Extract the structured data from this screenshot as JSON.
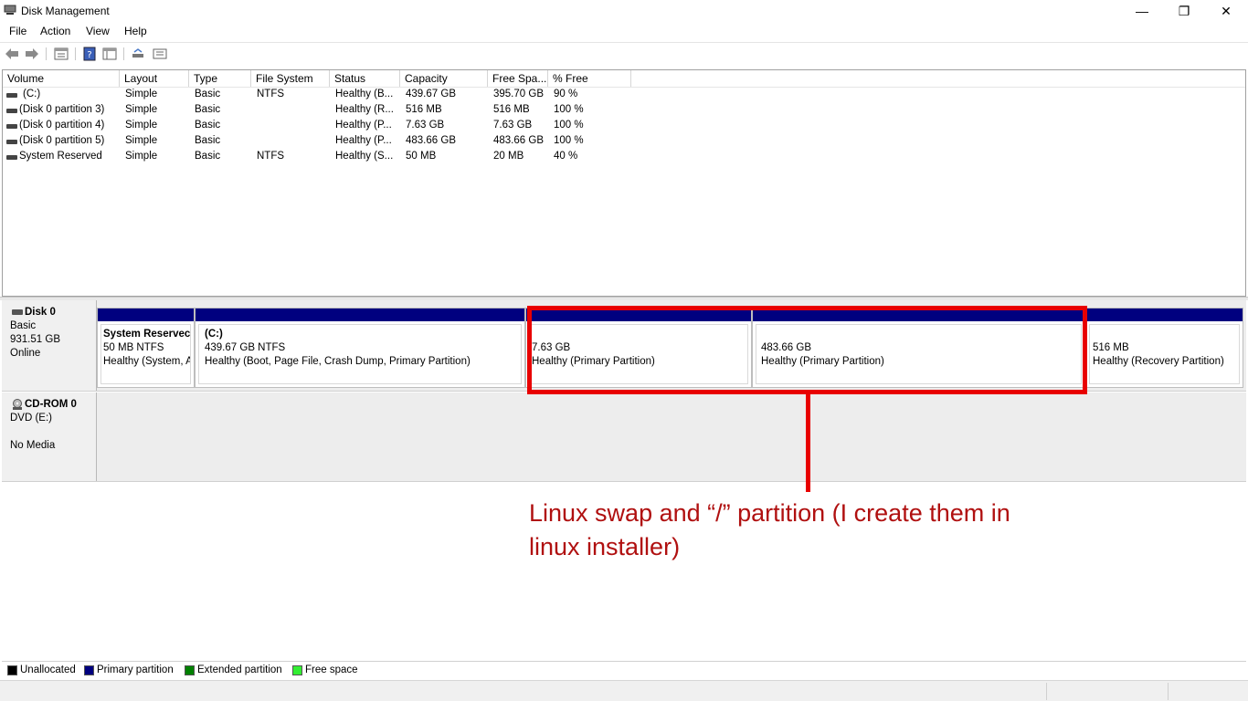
{
  "window": {
    "title": "Disk Management",
    "minimize_glyph": "—",
    "restore_glyph": "❐",
    "close_glyph": "✕"
  },
  "menu": [
    "File",
    "Action",
    "View",
    "Help"
  ],
  "toolbar_icons": [
    "back-arrow-icon",
    "forward-arrow-icon",
    "properties-icon",
    "help-icon",
    "details-icon",
    "rescan-icon",
    "settings-icon"
  ],
  "volume_list": {
    "columns": [
      "Volume",
      "Layout",
      "Type",
      "File System",
      "Status",
      "Capacity",
      "Free Spa...",
      "% Free"
    ],
    "rows": [
      {
        "volume": "(C:)",
        "layout": "Simple",
        "type": "Basic",
        "fs": "NTFS",
        "status": "Healthy (B...",
        "capacity": "439.67 GB",
        "free": "395.70 GB",
        "pct": "90 %"
      },
      {
        "volume": "(Disk 0 partition 3)",
        "layout": "Simple",
        "type": "Basic",
        "fs": "",
        "status": "Healthy (R...",
        "capacity": "516 MB",
        "free": "516 MB",
        "pct": "100 %"
      },
      {
        "volume": "(Disk 0 partition 4)",
        "layout": "Simple",
        "type": "Basic",
        "fs": "",
        "status": "Healthy (P...",
        "capacity": "7.63 GB",
        "free": "7.63 GB",
        "pct": "100 %"
      },
      {
        "volume": "(Disk 0 partition 5)",
        "layout": "Simple",
        "type": "Basic",
        "fs": "",
        "status": "Healthy (P...",
        "capacity": "483.66 GB",
        "free": "483.66 GB",
        "pct": "100 %"
      },
      {
        "volume": "System Reserved",
        "layout": "Simple",
        "type": "Basic",
        "fs": "NTFS",
        "status": "Healthy (S...",
        "capacity": "50 MB",
        "free": "20 MB",
        "pct": "40 %"
      }
    ]
  },
  "disks": [
    {
      "name": "Disk 0",
      "type": "Basic",
      "size": "931.51 GB",
      "state": "Online",
      "partitions": [
        {
          "name": "System Reservec",
          "size": "50 MB NTFS",
          "status": "Healthy (System, A"
        },
        {
          "name": "(C:)",
          "size": "439.67 GB NTFS",
          "status": "Healthy (Boot, Page File, Crash Dump, Primary Partition)"
        },
        {
          "name": "",
          "size": "7.63 GB",
          "status": "Healthy (Primary Partition)"
        },
        {
          "name": "",
          "size": "483.66 GB",
          "status": "Healthy (Primary Partition)"
        },
        {
          "name": "",
          "size": "516 MB",
          "status": "Healthy (Recovery Partition)"
        }
      ]
    },
    {
      "name": "CD-ROM 0",
      "type": "DVD (E:)",
      "state": "No Media"
    }
  ],
  "legend": [
    {
      "label": "Unallocated",
      "color": "#000000"
    },
    {
      "label": "Primary partition",
      "color": "#00007f"
    },
    {
      "label": "Extended partition",
      "color": "#008000"
    },
    {
      "label": "Free space",
      "color": "#33ee33"
    }
  ],
  "annotation": {
    "line1": "Linux swap and “/” partition (I create them in",
    "line2": "linux installer)",
    "color": "#e80000"
  }
}
